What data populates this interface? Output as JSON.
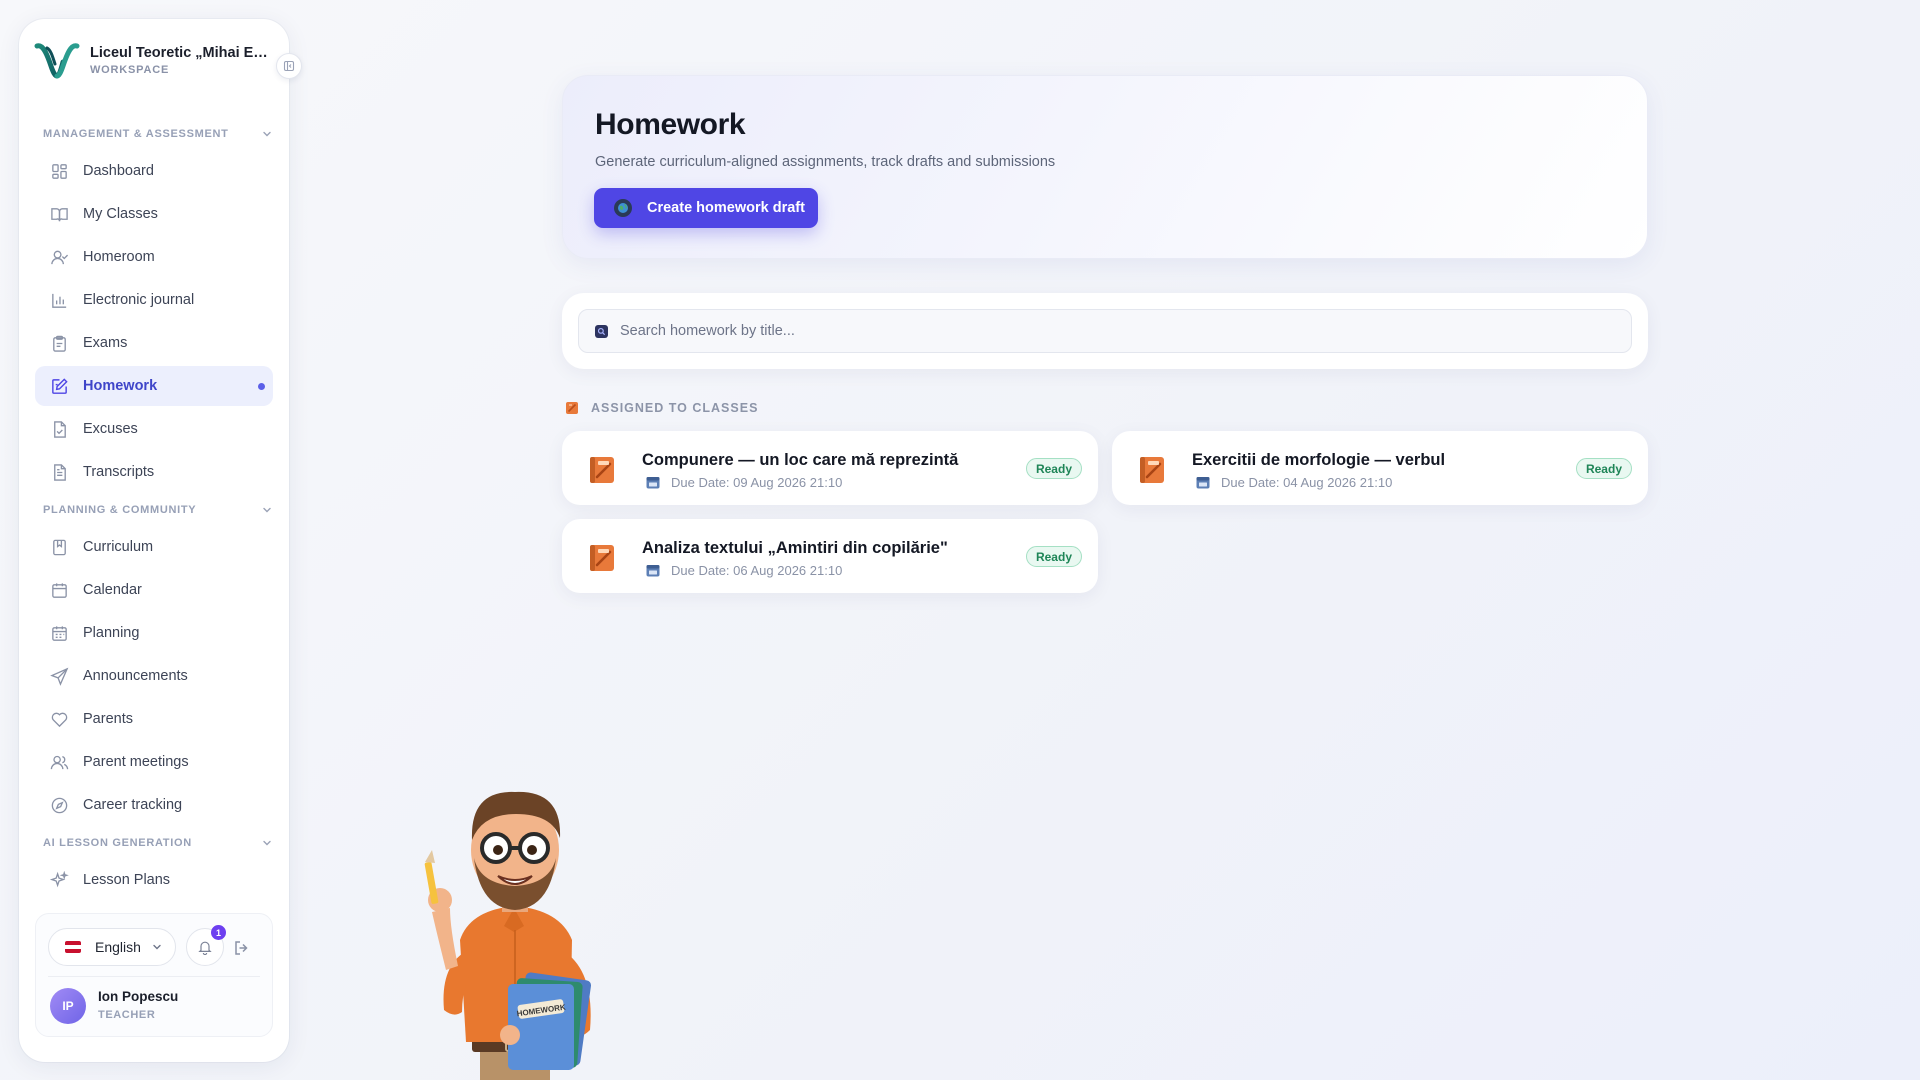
{
  "sidebar": {
    "brand": {
      "name": "Liceul Teoretic „Mihai Emi...",
      "subtitle": "WORKSPACE"
    },
    "sections": [
      {
        "title": "MANAGEMENT & ASSESSMENT",
        "items": [
          {
            "label": "Dashboard",
            "icon": "grid-icon"
          },
          {
            "label": "My Classes",
            "icon": "book-open-icon"
          },
          {
            "label": "Homeroom",
            "icon": "user-check-icon"
          },
          {
            "label": "Electronic journal",
            "icon": "bar-chart-icon"
          },
          {
            "label": "Exams",
            "icon": "clipboard-icon"
          },
          {
            "label": "Homework",
            "icon": "edit-icon",
            "active": true
          },
          {
            "label": "Excuses",
            "icon": "file-check-icon"
          },
          {
            "label": "Transcripts",
            "icon": "file-text-icon"
          }
        ]
      },
      {
        "title": "PLANNING & COMMUNITY",
        "items": [
          {
            "label": "Curriculum",
            "icon": "bookmark-icon"
          },
          {
            "label": "Calendar",
            "icon": "calendar-icon"
          },
          {
            "label": "Planning",
            "icon": "calendar-grid-icon"
          },
          {
            "label": "Announcements",
            "icon": "send-icon"
          },
          {
            "label": "Parents",
            "icon": "heart-icon"
          },
          {
            "label": "Parent meetings",
            "icon": "users-icon"
          },
          {
            "label": "Career tracking",
            "icon": "compass-icon"
          }
        ]
      },
      {
        "title": "AI LESSON GENERATION",
        "items": [
          {
            "label": "Lesson Plans",
            "icon": "sparkles-icon"
          }
        ]
      }
    ],
    "footer": {
      "language": "English",
      "notification_count": "1",
      "user": {
        "initials": "IP",
        "name": "Ion Popescu",
        "role": "TEACHER"
      }
    }
  },
  "hero": {
    "title": "Homework",
    "subtitle": "Generate curriculum-aligned assignments, track drafts and submissions",
    "create_button": "Create homework draft"
  },
  "search": {
    "placeholder": "Search homework by title..."
  },
  "assigned": {
    "title": "ASSIGNED TO CLASSES",
    "items": [
      {
        "title": "Compunere — un loc care mă reprezintă",
        "due": "Due Date: 09 Aug 2026 21:10",
        "status": "Ready"
      },
      {
        "title": "Exercitii de morfologie — verbul",
        "due": "Due Date: 04 Aug 2026 21:10",
        "status": "Ready"
      },
      {
        "title": "Analiza textului „Amintiri din copilărie\"",
        "due": "Due Date: 06 Aug 2026 21:10",
        "status": "Ready"
      }
    ]
  },
  "mascot": {
    "book_label": "HOMEWORK"
  },
  "colors": {
    "accent": "#4f46e5",
    "active_nav_bg": "#eceffd",
    "ready_badge": "#1e8557",
    "notification_badge": "#6d3ff0"
  }
}
